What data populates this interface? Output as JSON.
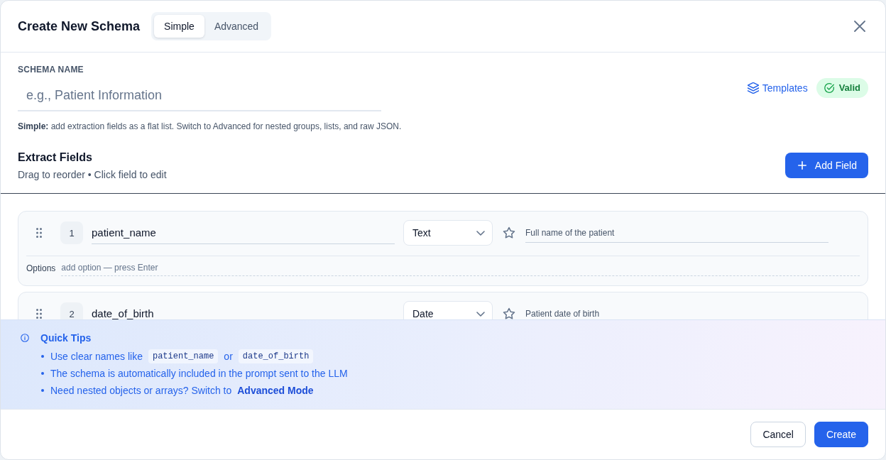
{
  "dialog": {
    "title": "Create New Schema",
    "modes": [
      {
        "label": "Simple",
        "selected": true
      },
      {
        "label": "Advanced",
        "selected": false
      }
    ]
  },
  "schema_name": {
    "label": "SCHEMA NAME",
    "placeholder": "e.g., Patient Information"
  },
  "templates_link": {
    "label": "Templates"
  },
  "validation": {
    "kind": "valid",
    "label": "Valid"
  },
  "help_text": "**Simple:** add extraction fields as a flat list. Switch to Advanced for nested groups, lists, and raw JSON.",
  "fields_section": {
    "title": "Extract Fields",
    "subtitle": "Drag to reorder • Click field to edit",
    "add_button": "Add Field"
  },
  "fields": [
    {
      "number": "1",
      "name": "patient_name",
      "type": "Text",
      "required": false,
      "description": "Full name of the patient",
      "options": {
        "label": "Options",
        "placeholder": "add option — press Enter"
      }
    },
    {
      "number": "2",
      "name": "date_of_birth",
      "type": "Date",
      "required": false,
      "description": "Patient date of birth"
    }
  ],
  "quick_tips": {
    "title": "Quick Tips",
    "items": [
      {
        "parts": [
          {
            "kind": "text",
            "text": "Use clear names like"
          },
          {
            "kind": "code",
            "text": "patient_name"
          },
          {
            "kind": "text",
            "text": "or"
          },
          {
            "kind": "code",
            "text": "date_of_birth"
          }
        ]
      },
      {
        "parts": [
          {
            "kind": "text",
            "text": "The schema is automatically included in the prompt sent to the LLM"
          }
        ]
      },
      {
        "parts": [
          {
            "kind": "text",
            "text": "Need nested objects or arrays? Switch to"
          },
          {
            "kind": "link",
            "text": "Advanced Mode"
          }
        ]
      }
    ]
  },
  "footer": {
    "buttons": [
      {
        "label": "Cancel",
        "kind": "secondary"
      },
      {
        "label": "Create",
        "kind": "primary"
      }
    ]
  }
}
